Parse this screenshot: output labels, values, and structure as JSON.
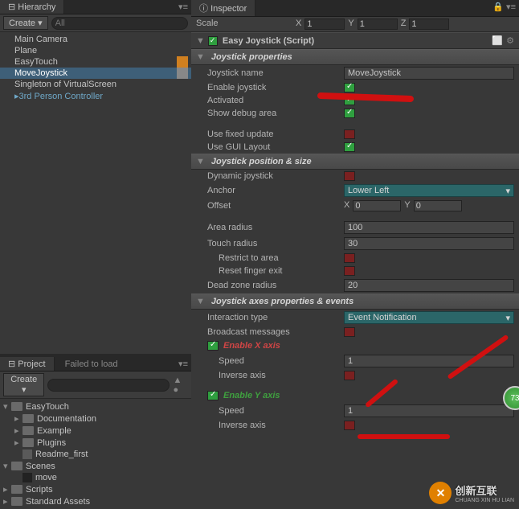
{
  "hierarchy": {
    "tab": "Hierarchy",
    "create": "Create",
    "search_placeholder": "All",
    "items": [
      "Main Camera",
      "Plane",
      "EasyTouch",
      "MoveJoystick",
      "Singleton of VirtualScreen",
      "3rd Person Controller"
    ]
  },
  "project": {
    "tab": "Project",
    "tab2": "Failed to load",
    "create": "Create",
    "items": [
      {
        "label": "EasyTouch",
        "lvl": 1,
        "fold": "▾",
        "ico": "folder"
      },
      {
        "label": "Documentation",
        "lvl": 2,
        "fold": "▸",
        "ico": "folder"
      },
      {
        "label": "Example",
        "lvl": 2,
        "fold": "▸",
        "ico": "folder"
      },
      {
        "label": "Plugins",
        "lvl": 2,
        "fold": "▸",
        "ico": "folder"
      },
      {
        "label": "Readme_first",
        "lvl": 2,
        "fold": "",
        "ico": "file"
      },
      {
        "label": "Scenes",
        "lvl": 1,
        "fold": "▾",
        "ico": "folder"
      },
      {
        "label": "move",
        "lvl": 2,
        "fold": "",
        "ico": "unity"
      },
      {
        "label": "Scripts",
        "lvl": 1,
        "fold": "▸",
        "ico": "folder"
      },
      {
        "label": "Standard Assets",
        "lvl": 1,
        "fold": "▸",
        "ico": "folder"
      }
    ]
  },
  "inspector": {
    "tab": "Inspector",
    "scale_label": "Scale",
    "x_label": "X",
    "y_label": "Y",
    "z_label": "Z",
    "x": "1",
    "y": "1",
    "z": "1",
    "component_title": "Easy Joystick (Script)",
    "sections": {
      "props": "Joystick properties",
      "pos": "Joystick position & size",
      "axes": "Joystick axes properties & events",
      "enable_x": "Enable X axis",
      "enable_y": "Enable Y axis"
    },
    "labels": {
      "name": "Joystick name",
      "enable": "Enable joystick",
      "activated": "Activated",
      "debug": "Show debug area",
      "fixed": "Use fixed update",
      "gui": "Use GUI Layout",
      "dynamic": "Dynamic joystick",
      "anchor": "Anchor",
      "offset": "Offset",
      "area": "Area radius",
      "touch": "Touch radius",
      "restrict": "Restrict to area",
      "reset": "Reset finger exit",
      "dead": "Dead zone radius",
      "interaction": "Interaction type",
      "broadcast": "Broadcast messages",
      "speed": "Speed",
      "inverse": "Inverse axis"
    },
    "values": {
      "name": "MoveJoystick",
      "anchor": "Lower Left",
      "offx": "0",
      "offy": "0",
      "area": "100",
      "touch": "30",
      "dead": "20",
      "interaction": "Event Notification",
      "speed_x": "1",
      "speed_y": "1"
    }
  },
  "misc": {
    "logo": "创新互联",
    "logo_sub": "CHUANG XIN HU LIAN",
    "badge": "73"
  }
}
